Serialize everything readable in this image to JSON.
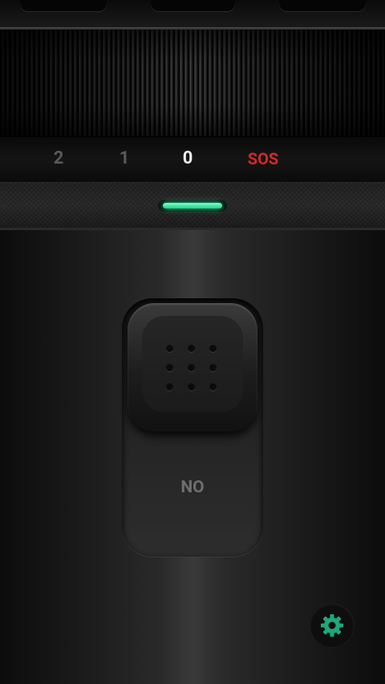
{
  "modes": {
    "mode_2": "2",
    "mode_1": "1",
    "mode_0": "0",
    "mode_sos": "SOS",
    "selected": "0",
    "sos_color": "#d32a2a"
  },
  "indicator": {
    "state": "on",
    "color": "#25e296"
  },
  "switch": {
    "label": "NO"
  },
  "settings": {
    "icon": "gear-icon",
    "color": "#1fa77a"
  }
}
